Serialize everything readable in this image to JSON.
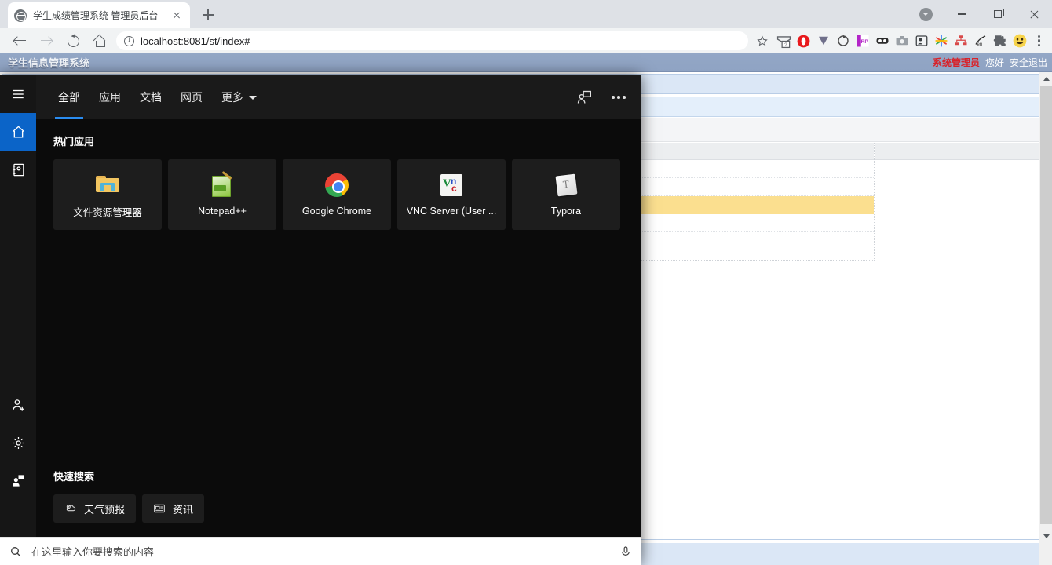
{
  "browser": {
    "tab": {
      "title": "学生成绩管理系统 管理员后台",
      "favicon": "globe-icon",
      "close": "×"
    },
    "new_tab": "+",
    "window": {
      "minimize": "–",
      "maximize": "□",
      "close": "×",
      "caret": "▾"
    },
    "address": {
      "url": "localhost:8081/st/index#",
      "security_icon": "info-icon"
    },
    "bookmark_star": "☆",
    "extensions": [
      "gmail-icon",
      "opera-shield-icon",
      "v-funnel-icon",
      "refresh-sync-icon",
      "axure-rp-icon",
      "dark-reader-icon",
      "camera-icon",
      "profile-card-icon",
      "asterisk-color-icon",
      "org-tree-icon",
      "translate-en-icon",
      "puzzle-extension-icon",
      "emoji-avatar-icon"
    ],
    "menu": "kebab-menu-icon"
  },
  "site": {
    "header": {
      "title": "学生信息管理系统",
      "role": "系统管理员",
      "greeting": "您好",
      "logout": "安全退出"
    }
  },
  "search_flyout": {
    "rail": [
      {
        "name": "hamburger",
        "icon": "hamburger-icon",
        "active": false
      },
      {
        "name": "home",
        "icon": "home-icon",
        "active": true
      },
      {
        "name": "library",
        "icon": "notebook-icon",
        "active": false
      },
      {
        "name": "account",
        "icon": "person-add-icon",
        "active": false
      },
      {
        "name": "settings",
        "icon": "gear-icon",
        "active": false
      },
      {
        "name": "feedback",
        "icon": "feedback-person-icon",
        "active": false
      }
    ],
    "tabs": [
      {
        "label": "全部",
        "active": true
      },
      {
        "label": "应用",
        "active": false
      },
      {
        "label": "文档",
        "active": false
      },
      {
        "label": "网页",
        "active": false
      },
      {
        "label": "更多",
        "active": false,
        "caret": true
      }
    ],
    "actions": [
      {
        "name": "feedback",
        "icon": "feedback-icon"
      },
      {
        "name": "more",
        "icon": "ellipsis-icon"
      }
    ],
    "top_apps_title": "热门应用",
    "tiles": [
      {
        "label": "文件资源管理器",
        "icon": "folder-icon"
      },
      {
        "label": "Notepad++",
        "icon": "notepadpp-icon"
      },
      {
        "label": "Google Chrome",
        "icon": "chrome-icon"
      },
      {
        "label": "VNC Server (User ...",
        "icon": "vnc-icon"
      },
      {
        "label": "Typora",
        "icon": "typora-icon"
      }
    ],
    "quick_search_title": "快速搜索",
    "chips": [
      {
        "label": "天气预报",
        "icon": "weather-icon"
      },
      {
        "label": "资讯",
        "icon": "news-icon"
      }
    ],
    "search_box": {
      "placeholder": "在这里输入你要搜索的内容",
      "value": "",
      "search_icon": "search-icon",
      "mic_icon": "microphone-icon"
    }
  },
  "colors": {
    "accent_blue": "#0b64c8",
    "tab_underline": "#2a8cf0",
    "flyout_bg": "#0b0b0b",
    "tile_bg": "#1d1d1d",
    "site_header": "#93a7c6",
    "role_red": "#d8232a",
    "row_highlight": "#fbdf8f"
  }
}
